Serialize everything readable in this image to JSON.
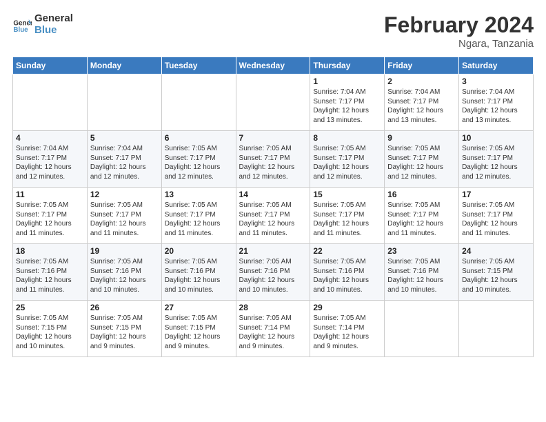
{
  "header": {
    "logo_line1": "General",
    "logo_line2": "Blue",
    "month_year": "February 2024",
    "location": "Ngara, Tanzania"
  },
  "days_of_week": [
    "Sunday",
    "Monday",
    "Tuesday",
    "Wednesday",
    "Thursday",
    "Friday",
    "Saturday"
  ],
  "weeks": [
    [
      {
        "day": "",
        "info": ""
      },
      {
        "day": "",
        "info": ""
      },
      {
        "day": "",
        "info": ""
      },
      {
        "day": "",
        "info": ""
      },
      {
        "day": "1",
        "info": "Sunrise: 7:04 AM\nSunset: 7:17 PM\nDaylight: 12 hours\nand 13 minutes."
      },
      {
        "day": "2",
        "info": "Sunrise: 7:04 AM\nSunset: 7:17 PM\nDaylight: 12 hours\nand 13 minutes."
      },
      {
        "day": "3",
        "info": "Sunrise: 7:04 AM\nSunset: 7:17 PM\nDaylight: 12 hours\nand 13 minutes."
      }
    ],
    [
      {
        "day": "4",
        "info": "Sunrise: 7:04 AM\nSunset: 7:17 PM\nDaylight: 12 hours\nand 12 minutes."
      },
      {
        "day": "5",
        "info": "Sunrise: 7:04 AM\nSunset: 7:17 PM\nDaylight: 12 hours\nand 12 minutes."
      },
      {
        "day": "6",
        "info": "Sunrise: 7:05 AM\nSunset: 7:17 PM\nDaylight: 12 hours\nand 12 minutes."
      },
      {
        "day": "7",
        "info": "Sunrise: 7:05 AM\nSunset: 7:17 PM\nDaylight: 12 hours\nand 12 minutes."
      },
      {
        "day": "8",
        "info": "Sunrise: 7:05 AM\nSunset: 7:17 PM\nDaylight: 12 hours\nand 12 minutes."
      },
      {
        "day": "9",
        "info": "Sunrise: 7:05 AM\nSunset: 7:17 PM\nDaylight: 12 hours\nand 12 minutes."
      },
      {
        "day": "10",
        "info": "Sunrise: 7:05 AM\nSunset: 7:17 PM\nDaylight: 12 hours\nand 12 minutes."
      }
    ],
    [
      {
        "day": "11",
        "info": "Sunrise: 7:05 AM\nSunset: 7:17 PM\nDaylight: 12 hours\nand 11 minutes."
      },
      {
        "day": "12",
        "info": "Sunrise: 7:05 AM\nSunset: 7:17 PM\nDaylight: 12 hours\nand 11 minutes."
      },
      {
        "day": "13",
        "info": "Sunrise: 7:05 AM\nSunset: 7:17 PM\nDaylight: 12 hours\nand 11 minutes."
      },
      {
        "day": "14",
        "info": "Sunrise: 7:05 AM\nSunset: 7:17 PM\nDaylight: 12 hours\nand 11 minutes."
      },
      {
        "day": "15",
        "info": "Sunrise: 7:05 AM\nSunset: 7:17 PM\nDaylight: 12 hours\nand 11 minutes."
      },
      {
        "day": "16",
        "info": "Sunrise: 7:05 AM\nSunset: 7:17 PM\nDaylight: 12 hours\nand 11 minutes."
      },
      {
        "day": "17",
        "info": "Sunrise: 7:05 AM\nSunset: 7:17 PM\nDaylight: 12 hours\nand 11 minutes."
      }
    ],
    [
      {
        "day": "18",
        "info": "Sunrise: 7:05 AM\nSunset: 7:16 PM\nDaylight: 12 hours\nand 11 minutes."
      },
      {
        "day": "19",
        "info": "Sunrise: 7:05 AM\nSunset: 7:16 PM\nDaylight: 12 hours\nand 10 minutes."
      },
      {
        "day": "20",
        "info": "Sunrise: 7:05 AM\nSunset: 7:16 PM\nDaylight: 12 hours\nand 10 minutes."
      },
      {
        "day": "21",
        "info": "Sunrise: 7:05 AM\nSunset: 7:16 PM\nDaylight: 12 hours\nand 10 minutes."
      },
      {
        "day": "22",
        "info": "Sunrise: 7:05 AM\nSunset: 7:16 PM\nDaylight: 12 hours\nand 10 minutes."
      },
      {
        "day": "23",
        "info": "Sunrise: 7:05 AM\nSunset: 7:16 PM\nDaylight: 12 hours\nand 10 minutes."
      },
      {
        "day": "24",
        "info": "Sunrise: 7:05 AM\nSunset: 7:15 PM\nDaylight: 12 hours\nand 10 minutes."
      }
    ],
    [
      {
        "day": "25",
        "info": "Sunrise: 7:05 AM\nSunset: 7:15 PM\nDaylight: 12 hours\nand 10 minutes."
      },
      {
        "day": "26",
        "info": "Sunrise: 7:05 AM\nSunset: 7:15 PM\nDaylight: 12 hours\nand 9 minutes."
      },
      {
        "day": "27",
        "info": "Sunrise: 7:05 AM\nSunset: 7:15 PM\nDaylight: 12 hours\nand 9 minutes."
      },
      {
        "day": "28",
        "info": "Sunrise: 7:05 AM\nSunset: 7:14 PM\nDaylight: 12 hours\nand 9 minutes."
      },
      {
        "day": "29",
        "info": "Sunrise: 7:05 AM\nSunset: 7:14 PM\nDaylight: 12 hours\nand 9 minutes."
      },
      {
        "day": "",
        "info": ""
      },
      {
        "day": "",
        "info": ""
      }
    ]
  ]
}
